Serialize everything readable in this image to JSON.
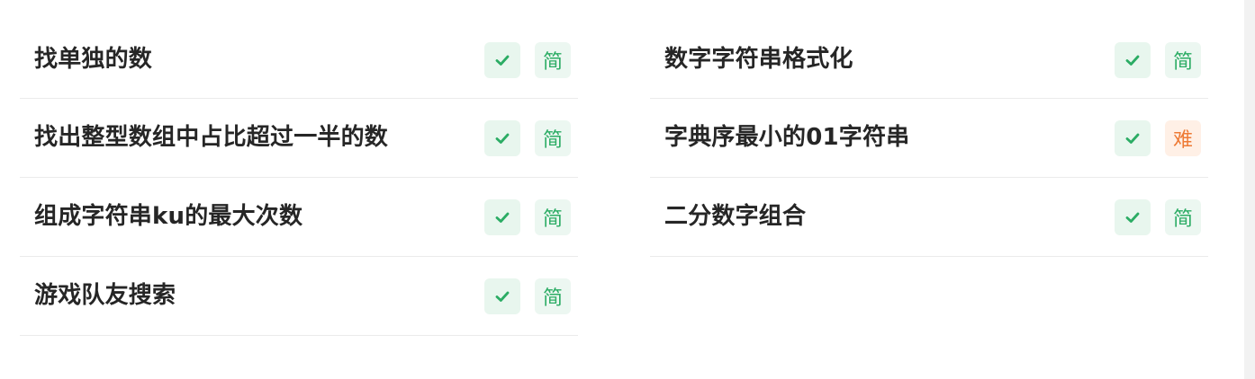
{
  "left_column": [
    {
      "title": "找单独的数",
      "status_icon": "check-icon",
      "difficulty": "简",
      "difficulty_level": "easy"
    },
    {
      "title": "找出整型数组中占比超过一半的数",
      "status_icon": "check-icon",
      "difficulty": "简",
      "difficulty_level": "easy"
    },
    {
      "title": "组成字符串ku的最大次数",
      "status_icon": "check-icon",
      "difficulty": "简",
      "difficulty_level": "easy"
    },
    {
      "title": "游戏队友搜索",
      "status_icon": "check-icon",
      "difficulty": "简",
      "difficulty_level": "easy"
    }
  ],
  "right_column": [
    {
      "title": "数字字符串格式化",
      "status_icon": "check-icon",
      "difficulty": "简",
      "difficulty_level": "easy"
    },
    {
      "title": "字典序最小的01字符串",
      "status_icon": "check-icon",
      "difficulty": "难",
      "difficulty_level": "hard"
    },
    {
      "title": "二分数字组合",
      "status_icon": "check-icon",
      "difficulty": "简",
      "difficulty_level": "easy"
    }
  ],
  "colors": {
    "check": "#2bac64",
    "easy": "#2bac64",
    "hard": "#ee7a35"
  }
}
